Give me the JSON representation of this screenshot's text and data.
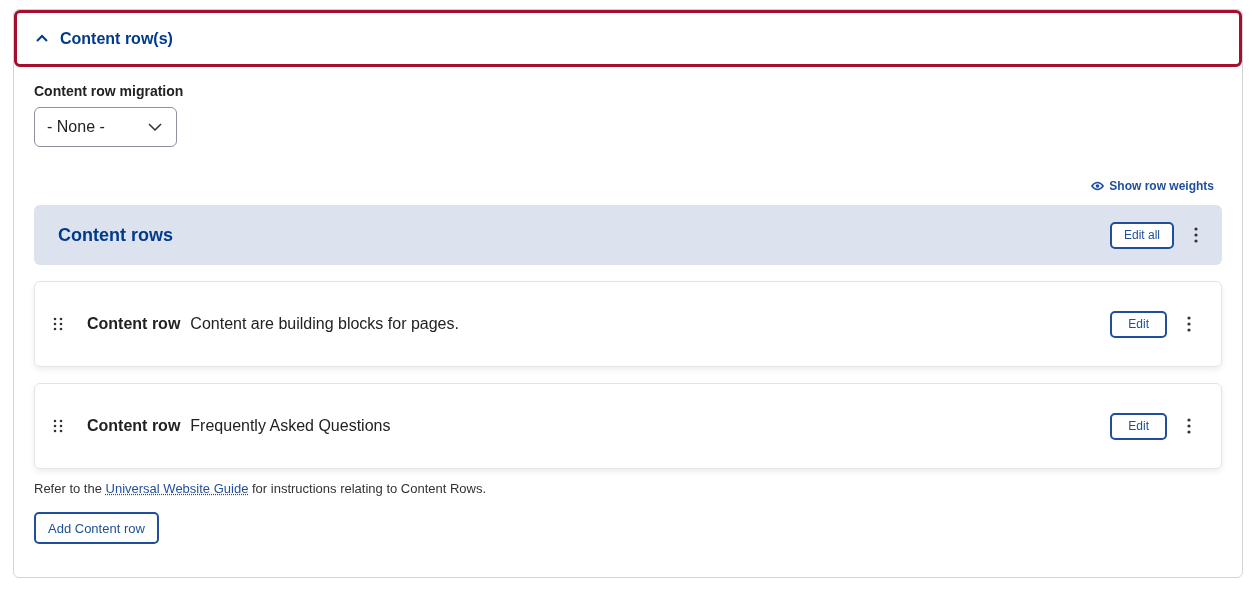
{
  "section": {
    "title": "Content row(s)",
    "expanded": true
  },
  "migration": {
    "label": "Content row migration",
    "value": "- None -"
  },
  "show_weights_link": "Show row weights",
  "content_rows_header": {
    "title": "Content rows",
    "button": "Edit all"
  },
  "rows": [
    {
      "type": "Content row",
      "summary": "Content are building blocks for pages.",
      "button": "Edit"
    },
    {
      "type": "Content row",
      "summary": "Frequently Asked Questions",
      "button": "Edit"
    }
  ],
  "help_text": {
    "before": "Refer to the ",
    "link": "Universal Website Guide",
    "after": " for instructions relating to Content Rows."
  },
  "add_button": "Add Content row"
}
